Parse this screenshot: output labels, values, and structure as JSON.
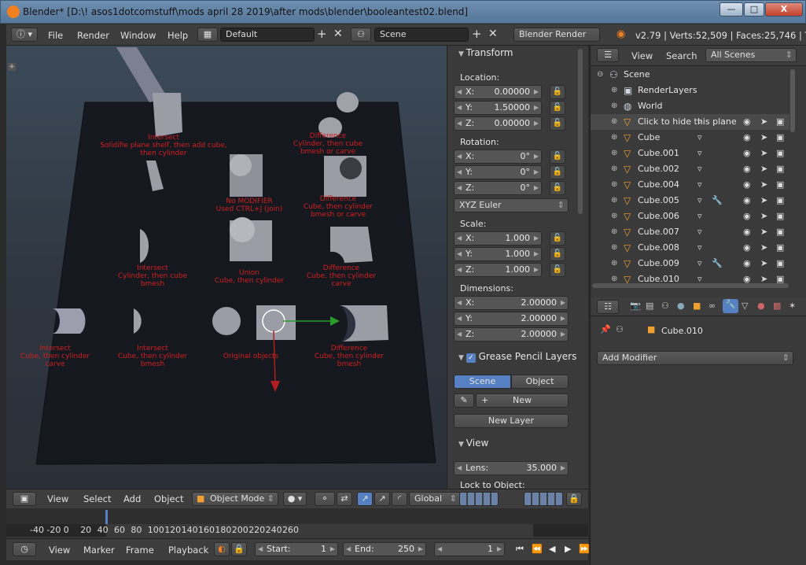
{
  "window": {
    "title": "Blender* [D:\\! asos1dotcomstuff\\mods april 28 2019\\after mods\\blender\\booleantest02.blend]",
    "min_label": "—",
    "max_label": "□",
    "close_label": "X"
  },
  "info_header": {
    "menus": [
      "File",
      "Render",
      "Window",
      "Help"
    ],
    "screen_layout": "Default",
    "scene": "Scene",
    "render_engine": "Blender Render",
    "stats": "v2.79 | Verts:52,509 | Faces:25,746 | Tri"
  },
  "viewport": {
    "labels": [
      "Intersect\nSolidifie plane shelf, then add cube, then cylinder",
      "Difference\nCylinder, then cube\nbmesh or carve",
      "No MODIFIER\nUsed CTRL+J (join)",
      "Difference\nCube, then cylinder\nbmesh or carve",
      "Intersect\nCylinder, then cube\nbmesh",
      "Union\nCube, then cylinder",
      "Difference\nCube, then cylinder\ncarve",
      "Intersect\nCube, then cylinder\ncarve",
      "Intersect\nCube, then cylinder\nbmesh",
      "Original objects",
      "Difference\nCube, then cylinder\nbmesh"
    ]
  },
  "npanel": {
    "transform_title": "Transform",
    "location_label": "Location:",
    "location": [
      {
        "axis": "X:",
        "value": "0.00000"
      },
      {
        "axis": "Y:",
        "value": "1.50000"
      },
      {
        "axis": "Z:",
        "value": "0.00000"
      }
    ],
    "rotation_label": "Rotation:",
    "rotation": [
      {
        "axis": "X:",
        "value": "0°"
      },
      {
        "axis": "Y:",
        "value": "0°"
      },
      {
        "axis": "Z:",
        "value": "0°"
      }
    ],
    "rotation_mode": "XYZ Euler",
    "scale_label": "Scale:",
    "scale": [
      {
        "axis": "X:",
        "value": "1.000"
      },
      {
        "axis": "Y:",
        "value": "1.000"
      },
      {
        "axis": "Z:",
        "value": "1.000"
      }
    ],
    "dimensions_label": "Dimensions:",
    "dimensions": [
      {
        "axis": "X:",
        "value": "2.00000"
      },
      {
        "axis": "Y:",
        "value": "2.00000"
      },
      {
        "axis": "Z:",
        "value": "2.00000"
      }
    ],
    "grease_title": "Grease Pencil Layers",
    "gp_tab_scene": "Scene",
    "gp_tab_object": "Object",
    "gp_new": "New",
    "gp_new_layer": "New Layer",
    "view_title": "View",
    "lens_label": "Lens:",
    "lens_value": "35.000",
    "lock_label": "Lock to Object:"
  },
  "outliner": {
    "menus": [
      "View",
      "Search"
    ],
    "filter": "All Scenes",
    "rows": [
      {
        "name": "Scene",
        "indent": 0,
        "icon": "scene-icon"
      },
      {
        "name": "RenderLayers",
        "indent": 1,
        "icon": "renderlayer-icon"
      },
      {
        "name": "World",
        "indent": 1,
        "icon": "world-icon"
      },
      {
        "name": "Click to hide this plane",
        "indent": 1,
        "icon": "mesh-icon",
        "selected": true,
        "vis": true
      },
      {
        "name": "Cube",
        "indent": 1,
        "icon": "mesh-icon",
        "vis": true
      },
      {
        "name": "Cube.001",
        "indent": 1,
        "icon": "mesh-icon",
        "vis": true
      },
      {
        "name": "Cube.002",
        "indent": 1,
        "icon": "mesh-icon",
        "vis": true
      },
      {
        "name": "Cube.004",
        "indent": 1,
        "icon": "mesh-icon",
        "vis": true
      },
      {
        "name": "Cube.005",
        "indent": 1,
        "icon": "mesh-icon",
        "vis": true,
        "wrench": true
      },
      {
        "name": "Cube.006",
        "indent": 1,
        "icon": "mesh-icon",
        "vis": true
      },
      {
        "name": "Cube.007",
        "indent": 1,
        "icon": "mesh-icon",
        "vis": true
      },
      {
        "name": "Cube.008",
        "indent": 1,
        "icon": "mesh-icon",
        "vis": true
      },
      {
        "name": "Cube.009",
        "indent": 1,
        "icon": "mesh-icon",
        "vis": true,
        "wrench": true
      },
      {
        "name": "Cube.010",
        "indent": 1,
        "icon": "mesh-icon",
        "vis": true
      }
    ]
  },
  "properties": {
    "object_name": "Cube.010",
    "add_modifier": "Add Modifier"
  },
  "view3d_header": {
    "menus": [
      "View",
      "Select",
      "Add",
      "Object"
    ],
    "mode": "Object Mode",
    "orientation": "Global"
  },
  "timeline": {
    "ticks": [
      "-40",
      "-20",
      "0",
      "20",
      "40",
      "60",
      "80",
      "100",
      "120",
      "140",
      "160",
      "180",
      "200",
      "220",
      "240",
      "260"
    ],
    "menus": [
      "View",
      "Marker",
      "Frame",
      "Playback"
    ],
    "start_label": "Start:",
    "start": "1",
    "end_label": "End:",
    "end": "250",
    "current": "1"
  },
  "colors": {
    "accent": "#5680c2",
    "label_red": "#d02020",
    "mesh_orange": "#f0a030"
  }
}
